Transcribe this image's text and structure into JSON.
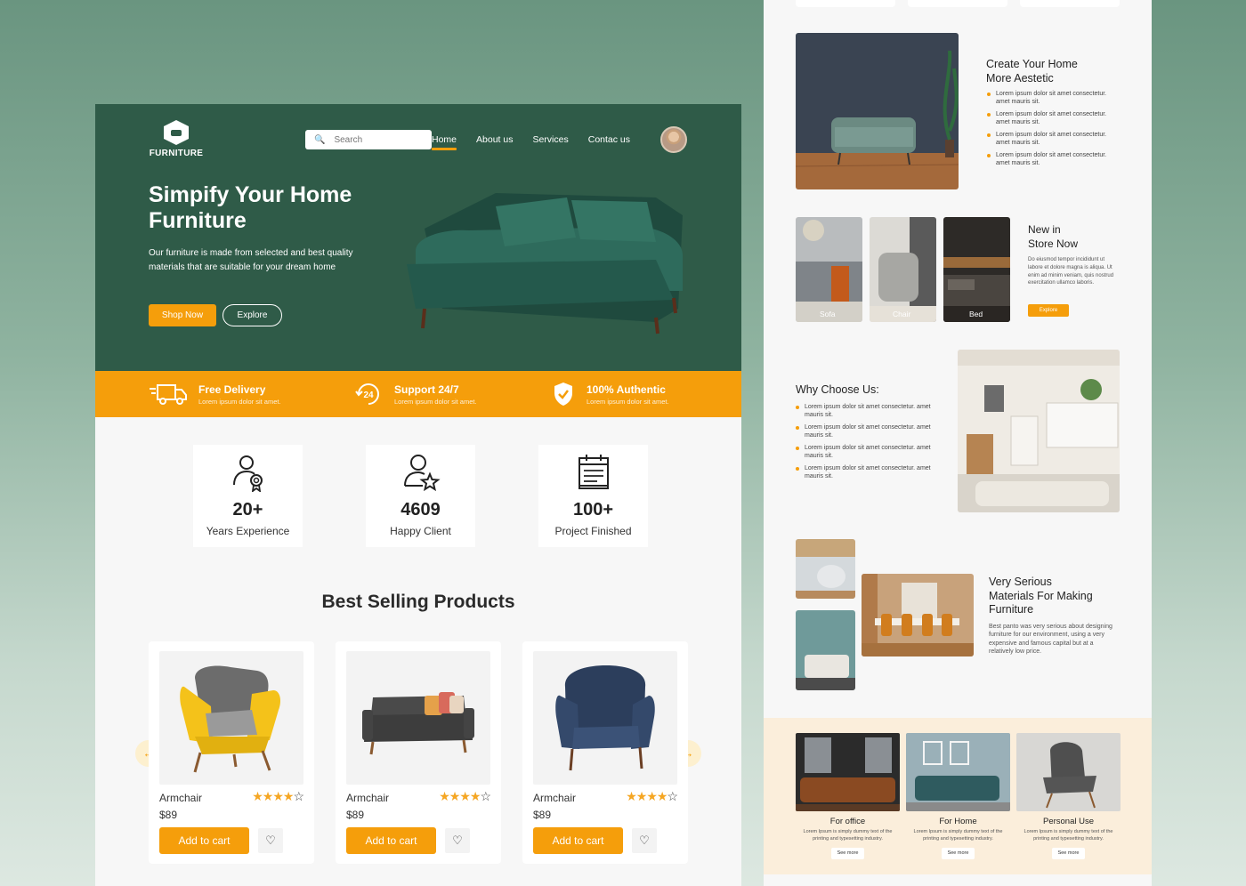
{
  "brand": {
    "name": "FURNITURE"
  },
  "search": {
    "placeholder": "Search"
  },
  "nav": {
    "items": [
      "Home",
      "About us",
      "Services",
      "Contac us"
    ]
  },
  "hero": {
    "title": "Simpify Your Home Furniture",
    "description": "Our furniture is made from selected and best quality materials that are suitable for your dream home",
    "shop_label": "Shop Now",
    "explore_label": "Explore"
  },
  "features": [
    {
      "title": "Free Delivery",
      "subtitle": "Lorem ipsum dolor sit amet.",
      "icon": "truck-icon"
    },
    {
      "title": "Support 24/7",
      "subtitle": "Lorem ipsum dolor sit amet.",
      "icon": "support-24-icon"
    },
    {
      "title": "100% Authentic",
      "subtitle": "Lorem ipsum dolor sit amet.",
      "icon": "shield-check-icon"
    }
  ],
  "stats": [
    {
      "value": "20+",
      "label": "Years Experience",
      "icon": "award-person-icon"
    },
    {
      "value": "4609",
      "label": "Happy Client",
      "icon": "user-star-icon"
    },
    {
      "value": "100+",
      "label": "Project Finished",
      "icon": "calendar-list-icon"
    }
  ],
  "best_selling": {
    "title": "Best Selling Products",
    "products": [
      {
        "name": "Armchair",
        "price": "$89",
        "rating": 4,
        "max_rating": 5,
        "cart_label": "Add to cart"
      },
      {
        "name": "Armchair",
        "price": "$89",
        "rating": 4,
        "max_rating": 5,
        "cart_label": "Add to cart"
      },
      {
        "name": "Armchair",
        "price": "$89",
        "rating": 4,
        "max_rating": 5,
        "cart_label": "Add to cart"
      }
    ]
  },
  "right": {
    "aesthetic": {
      "title_line1": "Create Your Home",
      "title_line2": "More Aestetic",
      "bullets": [
        "Lorem ipsum dolor sit amet consectetur. amet mauris sit.",
        "Lorem ipsum dolor sit amet consectetur. amet mauris sit.",
        "Lorem ipsum dolor sit amet consectetur. amet mauris sit.",
        "Lorem ipsum dolor sit amet consectetur. amet mauris sit."
      ]
    },
    "new_in": {
      "title_line1": "New in",
      "title_line2": "Store Now",
      "text": "Do eiusmod tempor incididunt ut labore et dolore magna is aliqua. Ut enim ad minim veniam, quis nostrud exercitation ullamco laboris.",
      "button": "Explore",
      "tiles": [
        "Sofa",
        "Chair",
        "Bed"
      ]
    },
    "why": {
      "title": "Why Choose Us:",
      "bullets": [
        "Lorem ipsum dolor sit amet consectetur. amet mauris sit.",
        "Lorem ipsum dolor sit amet consectetur. amet mauris sit.",
        "Lorem ipsum dolor sit amet consectetur. amet mauris sit.",
        "Lorem ipsum dolor sit amet consectetur. amet mauris sit."
      ]
    },
    "materials": {
      "title_line1": "Very Serious",
      "title_line2": "Materials For Making",
      "title_line3": "Furniture",
      "text": "Best panto was very serious about designing furniture for our environment, using a very expensive and famous capital but at a relatively low price."
    },
    "categories": [
      {
        "title": "For office",
        "text": "Lorem Ipsum is simply dummy text of the printing and typesetting industry.",
        "button": "See more"
      },
      {
        "title": "For Home",
        "text": "Lorem Ipsum is simply dummy text of the printing and typesetting industry.",
        "button": "See more"
      },
      {
        "title": "Personal Use",
        "text": "Lorem Ipsum is simply dummy text of the printing and typesetting industry.",
        "button": "See more"
      }
    ]
  },
  "colors": {
    "primary_green": "#2f5b48",
    "accent_orange": "#f59e0b",
    "background": "#f7f7f7"
  }
}
